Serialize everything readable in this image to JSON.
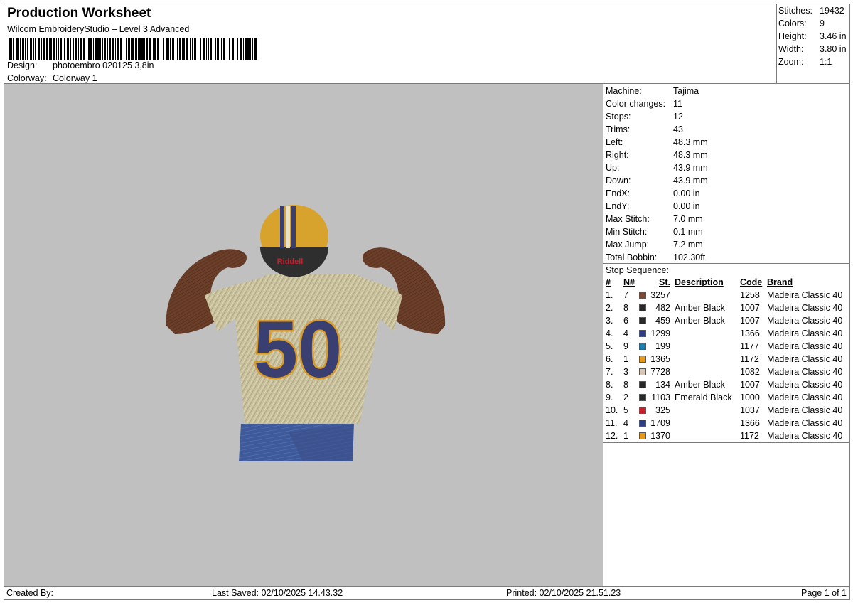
{
  "header": {
    "title": "Production Worksheet",
    "software": "Wilcom EmbroideryStudio – Level 3 Advanced",
    "design_label": "Design:",
    "design_value": "photoembro 020125 3,8in",
    "colorway_label": "Colorway:",
    "colorway_value": "Colorway 1"
  },
  "summary": {
    "rows": [
      {
        "label": "Stitches:",
        "value": "19432"
      },
      {
        "label": "Colors:",
        "value": "9"
      },
      {
        "label": "Height:",
        "value": "3.46 in"
      },
      {
        "label": "Width:",
        "value": "3.80 in"
      },
      {
        "label": "Zoom:",
        "value": "1:1"
      }
    ]
  },
  "design_image": {
    "jersey_number": "50",
    "helmet_brand": "Riddell",
    "colors": {
      "background": "#c0c0c0",
      "jersey": "#c9c19c",
      "number_fill": "#3a3f72",
      "number_outline": "#d89a2a",
      "helmet": "#d8a32c",
      "skin": "#6a3e28",
      "pants": "#3f5a9a"
    }
  },
  "machine": {
    "rows": [
      {
        "label": "Machine:",
        "value": "Tajima"
      },
      {
        "label": "Color changes:",
        "value": "11"
      },
      {
        "label": "Stops:",
        "value": "12"
      },
      {
        "label": "Trims:",
        "value": "43"
      },
      {
        "label": "Left:",
        "value": "48.3 mm"
      },
      {
        "label": "Right:",
        "value": "48.3 mm"
      },
      {
        "label": "Up:",
        "value": "43.9 mm"
      },
      {
        "label": "Down:",
        "value": "43.9 mm"
      },
      {
        "label": "EndX:",
        "value": "0.00 in"
      },
      {
        "label": "EndY:",
        "value": "0.00 in"
      },
      {
        "label": "Max Stitch:",
        "value": "7.0 mm"
      },
      {
        "label": "Min Stitch:",
        "value": "0.1 mm"
      },
      {
        "label": "Max Jump:",
        "value": "7.2 mm"
      },
      {
        "label": "Total Bobbin:",
        "value": "102.30ft"
      }
    ]
  },
  "stop_sequence": {
    "title": "Stop Sequence:",
    "headers": {
      "num": "#",
      "needle": "N#",
      "st": "St.",
      "description": "Description",
      "code": "Code",
      "brand": "Brand"
    },
    "rows": [
      {
        "num": "1.",
        "needle": "7",
        "color": "#7a4a36",
        "st": "3257",
        "description": "",
        "code": "1258",
        "brand": "Madeira Classic 40"
      },
      {
        "num": "2.",
        "needle": "8",
        "color": "#2a2a2a",
        "st": "482",
        "description": "Amber Black",
        "code": "1007",
        "brand": "Madeira Classic 40"
      },
      {
        "num": "3.",
        "needle": "6",
        "color": "#2a2a2a",
        "st": "459",
        "description": "Amber Black",
        "code": "1007",
        "brand": "Madeira Classic 40"
      },
      {
        "num": "4.",
        "needle": "4",
        "color": "#2e3e86",
        "st": "1299",
        "description": "",
        "code": "1366",
        "brand": "Madeira Classic 40"
      },
      {
        "num": "5.",
        "needle": "9",
        "color": "#1b7fb2",
        "st": "199",
        "description": "",
        "code": "1177",
        "brand": "Madeira Classic 40"
      },
      {
        "num": "6.",
        "needle": "1",
        "color": "#e39a1c",
        "st": "1365",
        "description": "",
        "code": "1172",
        "brand": "Madeira Classic 40"
      },
      {
        "num": "7.",
        "needle": "3",
        "color": "#d9c8b8",
        "st": "7728",
        "description": "",
        "code": "1082",
        "brand": "Madeira Classic 40"
      },
      {
        "num": "8.",
        "needle": "8",
        "color": "#2a2a2a",
        "st": "134",
        "description": "Amber Black",
        "code": "1007",
        "brand": "Madeira Classic 40"
      },
      {
        "num": "9.",
        "needle": "2",
        "color": "#262a26",
        "st": "1103",
        "description": "Emerald Black",
        "code": "1000",
        "brand": "Madeira Classic 40"
      },
      {
        "num": "10.",
        "needle": "5",
        "color": "#c8202a",
        "st": "325",
        "description": "",
        "code": "1037",
        "brand": "Madeira Classic 40"
      },
      {
        "num": "11.",
        "needle": "4",
        "color": "#2e3e86",
        "st": "1709",
        "description": "",
        "code": "1366",
        "brand": "Madeira Classic 40"
      },
      {
        "num": "12.",
        "needle": "1",
        "color": "#e39a1c",
        "st": "1370",
        "description": "",
        "code": "1172",
        "brand": "Madeira Classic 40"
      }
    ]
  },
  "footer": {
    "created_by": "Created By:",
    "last_saved": "Last Saved: 02/10/2025 14.43.32",
    "printed": "Printed: 02/10/2025 21.51.23",
    "page": "Page 1 of 1"
  }
}
